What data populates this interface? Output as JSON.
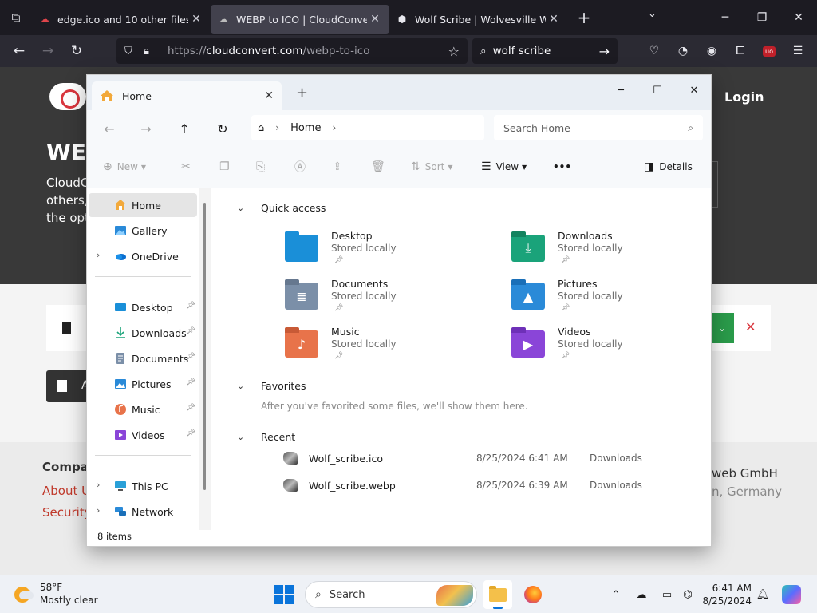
{
  "browser": {
    "tabs": [
      {
        "title": "edge.ico and 10 other files | File",
        "active": false
      },
      {
        "title": "WEBP to ICO | CloudConvert",
        "active": true
      },
      {
        "title": "Wolf Scribe | Wolvesville Wiki | ",
        "active": false
      }
    ],
    "url_proto": "https://",
    "url_host": "cloudconvert.com",
    "url_path": "/webp-to-ico",
    "search_value": "wolf scribe",
    "addon_badge": "uo"
  },
  "page": {
    "login": "Login",
    "heading": "WE",
    "para_lines": [
      "CloudC",
      "others,",
      "the opt"
    ],
    "add_files_letter": "A",
    "footer_company": "Compar",
    "footer_about": "About U",
    "footer_security": "Security",
    "footer_gmbh": "web GmbH",
    "footer_germany": "n, Germany"
  },
  "explorer": {
    "tab_title": "Home",
    "crumb": "Home",
    "search_placeholder": "Search Home",
    "commands": {
      "new": "New",
      "sort": "Sort",
      "view": "View",
      "more": "•••",
      "details": "Details"
    },
    "sidebar": [
      {
        "label": "Home",
        "icon": "home-icon",
        "selected": true
      },
      {
        "label": "Gallery",
        "icon": "gallery-icon"
      },
      {
        "label": "OneDrive",
        "icon": "cloud-icon",
        "expandable": true
      },
      {
        "label": "Desktop",
        "icon": "desktop-folder-icon",
        "pinned": true
      },
      {
        "label": "Downloads",
        "icon": "download-icon",
        "pinned": true
      },
      {
        "label": "Documents",
        "icon": "documents-folder-icon",
        "pinned": true
      },
      {
        "label": "Pictures",
        "icon": "pictures-folder-icon",
        "pinned": true
      },
      {
        "label": "Music",
        "icon": "music-folder-icon",
        "pinned": true
      },
      {
        "label": "Videos",
        "icon": "videos-folder-icon",
        "pinned": true
      },
      {
        "label": "This PC",
        "icon": "computer-icon",
        "expandable": true
      },
      {
        "label": "Network",
        "icon": "network-icon",
        "expandable": true
      }
    ],
    "status": "8 items",
    "sections": {
      "quick_access": "Quick access",
      "favorites": "Favorites",
      "favorites_hint": "After you've favorited some files, we'll show them here.",
      "recent": "Recent"
    },
    "quick_access": [
      {
        "name": "Desktop",
        "sub": "Stored locally",
        "color": "#1a8fd8",
        "glyph": ""
      },
      {
        "name": "Downloads",
        "sub": "Stored locally",
        "color": "#1aa37a",
        "glyph": "⤓"
      },
      {
        "name": "Documents",
        "sub": "Stored locally",
        "color": "#7b8fa8",
        "glyph": "≣"
      },
      {
        "name": "Pictures",
        "sub": "Stored locally",
        "color": "#2a8ad8",
        "glyph": "▲"
      },
      {
        "name": "Music",
        "sub": "Stored locally",
        "color": "#e8734a",
        "glyph": "♪"
      },
      {
        "name": "Videos",
        "sub": "Stored locally",
        "color": "#8a45d8",
        "glyph": "▶"
      }
    ],
    "recent": [
      {
        "name": "Wolf_scribe.ico",
        "date": "8/25/2024 6:41 AM",
        "location": "Downloads"
      },
      {
        "name": "Wolf_scribe.webp",
        "date": "8/25/2024 6:39 AM",
        "location": "Downloads"
      }
    ]
  },
  "taskbar": {
    "temp": "58°F",
    "condition": "Mostly clear",
    "search": "Search",
    "time": "6:41 AM",
    "date": "8/25/2024"
  }
}
